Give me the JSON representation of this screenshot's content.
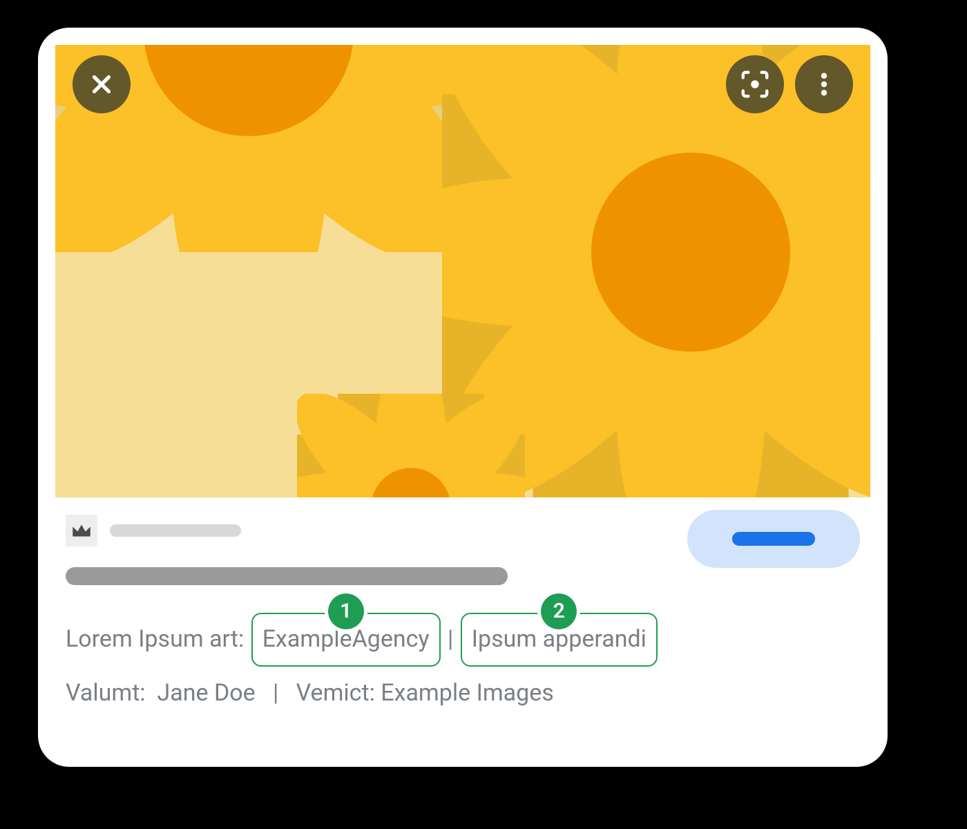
{
  "hero": {
    "close_icon": "close-icon",
    "lens_icon": "lens-icon",
    "more_icon": "more-vert-icon"
  },
  "meta": {
    "crown_icon": "crown-icon"
  },
  "credits": {
    "line1": {
      "prefix": "Lorem Ipsum art:",
      "callout1": {
        "badge": "1",
        "text": "ExampleAgency"
      },
      "separator": "|",
      "callout2": {
        "badge": "2",
        "text": "Ipsum apperandi"
      }
    },
    "line2": {
      "creator_label": "Valumt:",
      "creator_value": "Jane Doe",
      "separator": "|",
      "copyright_label": "Vemict:",
      "copyright_value": "Example Images"
    }
  }
}
